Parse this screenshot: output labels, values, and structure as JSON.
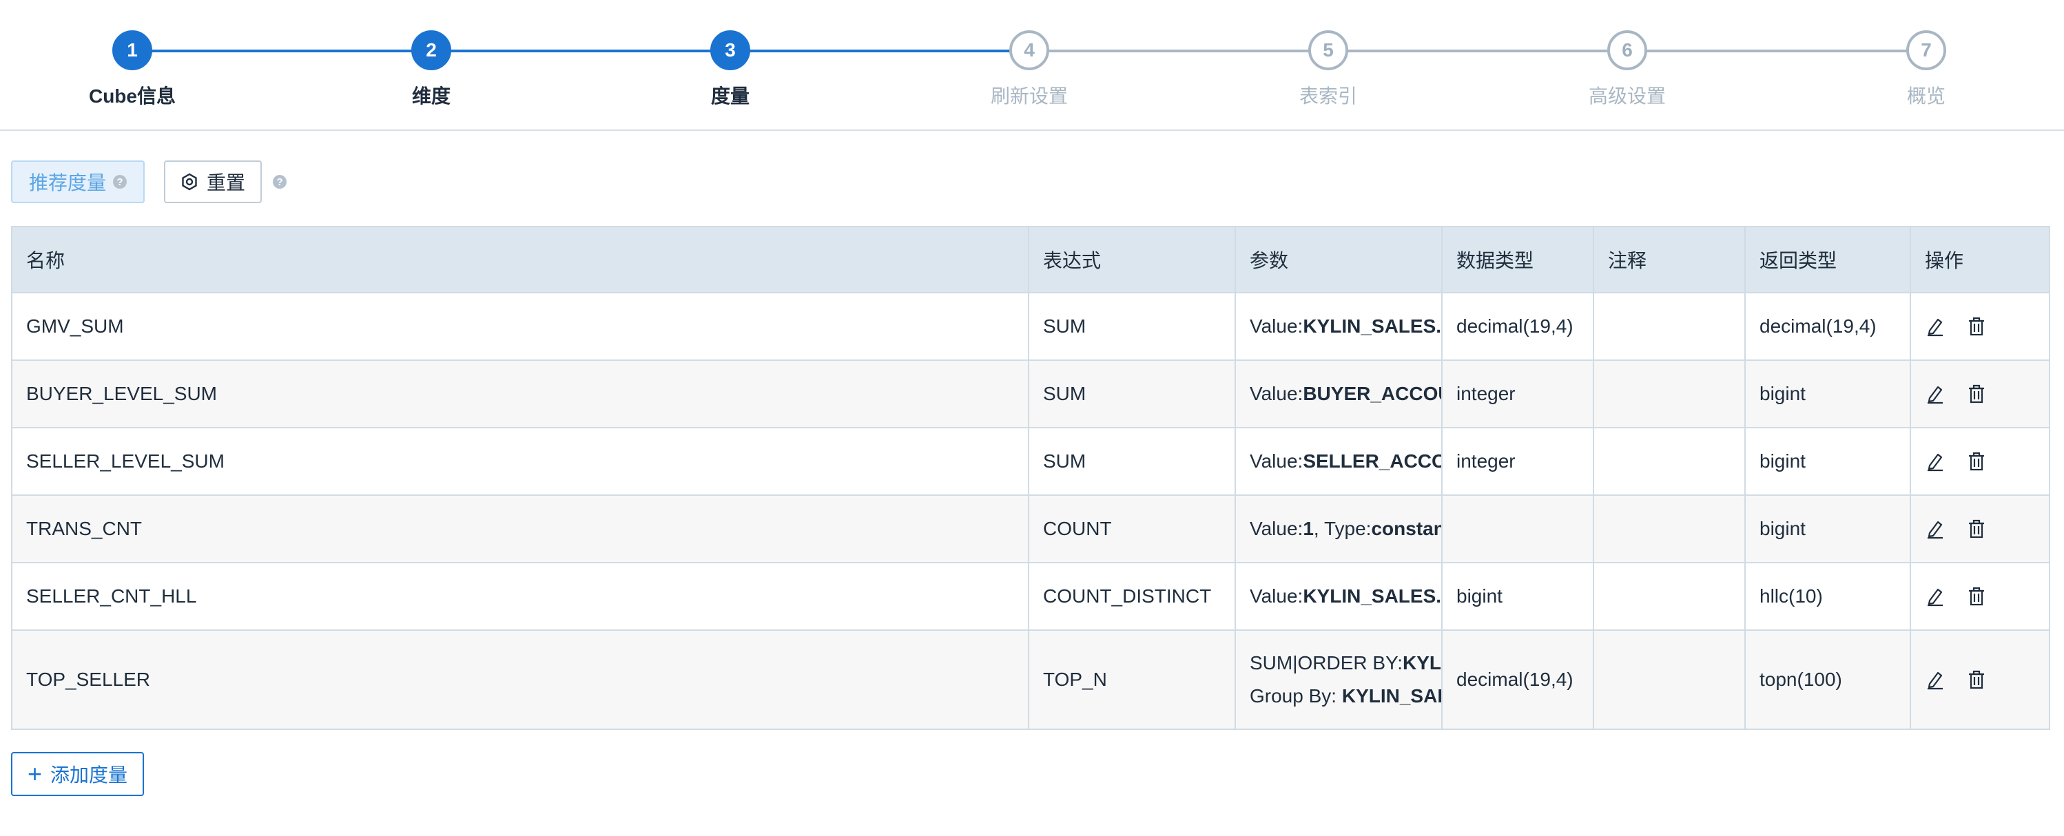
{
  "steps": [
    {
      "num": "1",
      "label": "Cube信息",
      "state": "done"
    },
    {
      "num": "2",
      "label": "维度",
      "state": "done"
    },
    {
      "num": "3",
      "label": "度量",
      "state": "done"
    },
    {
      "num": "4",
      "label": "刷新设置",
      "state": "todo"
    },
    {
      "num": "5",
      "label": "表索引",
      "state": "todo"
    },
    {
      "num": "6",
      "label": "高级设置",
      "state": "todo"
    },
    {
      "num": "7",
      "label": "概览",
      "state": "todo"
    }
  ],
  "toolbar": {
    "recommend_label": "推荐度量",
    "help_glyph": "?",
    "reset_label": "重置"
  },
  "table": {
    "headers": {
      "name": "名称",
      "expression": "表达式",
      "params": "参数",
      "data_type": "数据类型",
      "comment": "注释",
      "return_type": "返回类型",
      "actions": "操作"
    },
    "rows": [
      {
        "name": "GMV_SUM",
        "expression": "SUM",
        "p1_label": "Value:",
        "p1_value": "KYLIN_SALES.PRICE",
        "data_type": "decimal(19,4)",
        "comment": "",
        "return_type": "decimal(19,4)"
      },
      {
        "name": "BUYER_LEVEL_SUM",
        "expression": "SUM",
        "p1_label": "Value:",
        "p1_value": "BUYER_ACCOUNT.ACCOUNT_BUYER_LEVEL",
        "data_type": "integer",
        "comment": "",
        "return_type": "bigint"
      },
      {
        "name": "SELLER_LEVEL_SUM",
        "expression": "SUM",
        "p1_label": "Value:",
        "p1_value": "SELLER_ACCOUNT.ACCOUNT_SELLER_LEVEL",
        "data_type": "integer",
        "comment": "",
        "return_type": "bigint"
      },
      {
        "name": "TRANS_CNT",
        "expression": "COUNT",
        "p1_label": "Value:",
        "p1_value": "1",
        "p1_sep": ", Type:",
        "p1_type": "constant",
        "data_type": "",
        "comment": "",
        "return_type": "bigint"
      },
      {
        "name": "SELLER_CNT_HLL",
        "expression": "COUNT_DISTINCT",
        "p1_label": "Value:",
        "p1_value": "KYLIN_SALES.SELLER_ID",
        "data_type": "bigint",
        "comment": "",
        "return_type": "hllc(10)"
      },
      {
        "name": "TOP_SELLER",
        "expression": "TOP_N",
        "p1_label": "SUM|ORDER BY:",
        "p1_value": "KYLIN_SALES.PRICE",
        "p2_label": "Group By: ",
        "p2_value": "KYLIN_SALES.SELLER_ID",
        "data_type": "decimal(19,4)",
        "comment": "",
        "return_type": "topn(100)"
      }
    ]
  },
  "add_button_label": "添加度量",
  "colors": {
    "primary": "#1a73d1",
    "inactive": "#a9b7c4",
    "header_bg": "#dbe6ee",
    "recommend_bg": "#e6f1fb"
  }
}
